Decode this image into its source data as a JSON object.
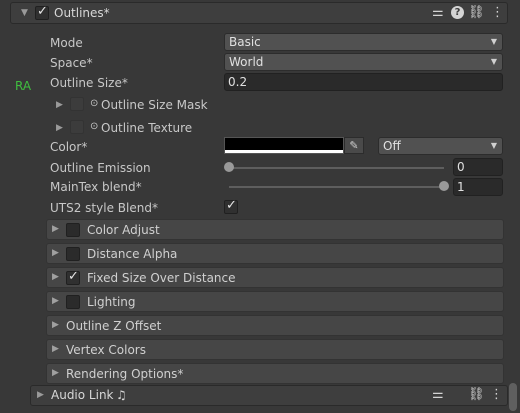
{
  "outlines_header": {
    "title": "Outlines*",
    "enabled": true,
    "icons": [
      "sliders-icon",
      "help-icon",
      "link-icon",
      "kebab-menu-icon"
    ]
  },
  "side_tag": "RA",
  "fields": {
    "mode": {
      "label": "Mode",
      "value": "Basic"
    },
    "space": {
      "label": "Space*",
      "value": "World"
    },
    "outline_size": {
      "label": "Outline Size*",
      "value": "0.2"
    },
    "outline_size_mask": {
      "label": "Outline Size Mask",
      "symbol": "⊙"
    },
    "outline_texture": {
      "label": "Outline Texture",
      "symbol": "⊙"
    },
    "color": {
      "label": "Color*",
      "color_value": "#000000",
      "mode_value": "Off"
    },
    "outline_emission": {
      "label": "Outline Emission",
      "value": "0",
      "fraction": 0
    },
    "maintex_blend": {
      "label": "MainTex blend*",
      "value": "1",
      "fraction": 1
    },
    "uts2_blend": {
      "label": "UTS2 style Blend*",
      "checked": true
    }
  },
  "sections": [
    {
      "label": "Color Adjust",
      "has_checkbox": true,
      "checked": false
    },
    {
      "label": "Distance Alpha",
      "has_checkbox": true,
      "checked": false
    },
    {
      "label": "Fixed Size Over Distance",
      "has_checkbox": true,
      "checked": true
    },
    {
      "label": "Lighting",
      "has_checkbox": true,
      "checked": false
    },
    {
      "label": "Outline Z Offset",
      "has_checkbox": false
    },
    {
      "label": "Vertex Colors",
      "has_checkbox": false
    },
    {
      "label": "Rendering Options*",
      "has_checkbox": false
    }
  ],
  "audio_link_header": {
    "title": "Audio Link",
    "note_symbol": "♫",
    "icons": [
      "sliders-icon",
      "link-icon",
      "kebab-menu-icon"
    ]
  },
  "colors": {
    "panel_bg": "#383838",
    "accent_green": "#3fbf3f"
  }
}
